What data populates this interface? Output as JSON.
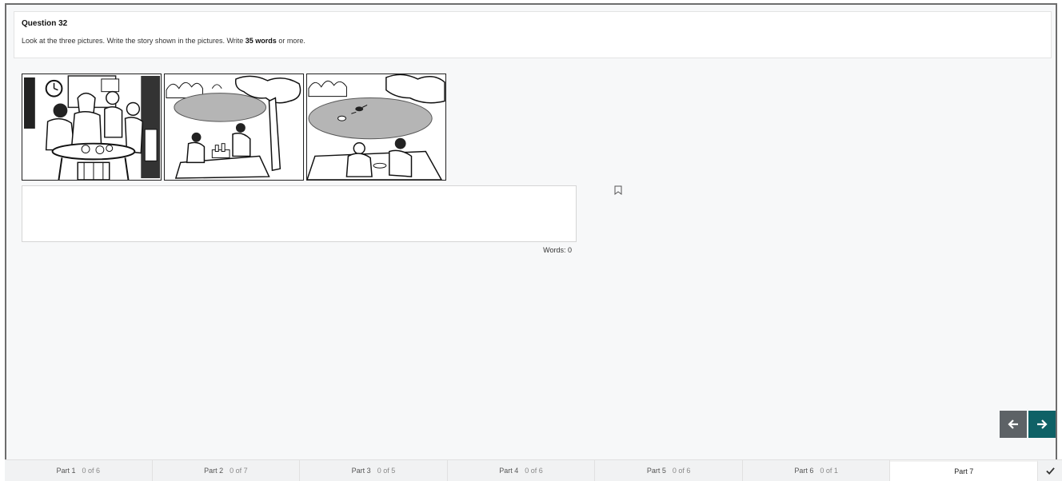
{
  "question": {
    "title": "Question 32",
    "instruction_prefix": "Look at the three pictures. Write the story shown in the pictures. Write ",
    "instruction_bold": "35 words",
    "instruction_suffix": " or more."
  },
  "pictures": [
    {
      "scene": "family-kitchen"
    },
    {
      "scene": "picnic-by-lake"
    },
    {
      "scene": "swimming-in-lake"
    }
  ],
  "answer": {
    "value": "",
    "word_count_label": "Words: 0"
  },
  "icons": {
    "bookmark": "bookmark-icon",
    "prev": "arrow-left-icon",
    "next": "arrow-right-icon",
    "check": "check-icon"
  },
  "colors": {
    "next_button": "#0f6166",
    "prev_button": "#5d6266"
  },
  "parts": [
    {
      "label": "Part 1",
      "count": "0 of 6"
    },
    {
      "label": "Part 2",
      "count": "0 of 7"
    },
    {
      "label": "Part 3",
      "count": "0 of 5"
    },
    {
      "label": "Part 4",
      "count": "0 of 6"
    },
    {
      "label": "Part 5",
      "count": "0 of 6"
    },
    {
      "label": "Part 6",
      "count": "0 of 1"
    },
    {
      "label": "Part 7",
      "count": ""
    }
  ]
}
